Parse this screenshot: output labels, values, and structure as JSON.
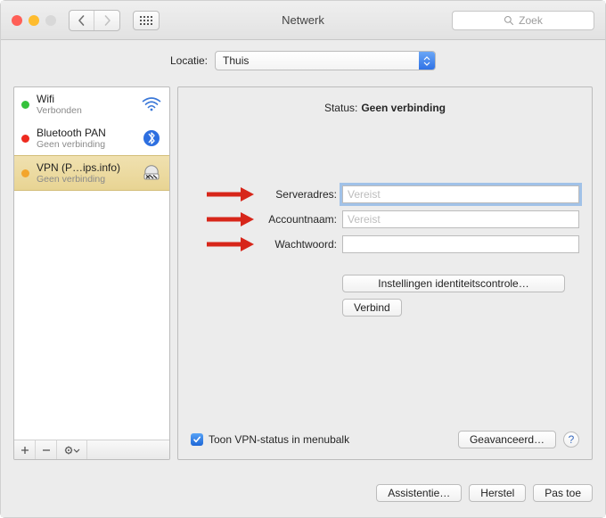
{
  "window": {
    "title": "Netwerk"
  },
  "search": {
    "placeholder": "Zoek"
  },
  "location": {
    "label": "Locatie:",
    "value": "Thuis"
  },
  "sidebar": {
    "items": [
      {
        "name": "Wifi",
        "status": "Verbonden",
        "dot": "green",
        "icon": "wifi"
      },
      {
        "name": "Bluetooth PAN",
        "status": "Geen verbinding",
        "dot": "red",
        "icon": "bluetooth"
      },
      {
        "name": "VPN (P…ips.info)",
        "status": "Geen verbinding",
        "dot": "orange",
        "icon": "vpn"
      }
    ]
  },
  "detail": {
    "status_label": "Status:",
    "status_value": "Geen verbinding",
    "fields": {
      "server_label": "Serveradres:",
      "server_placeholder": "Vereist",
      "account_label": "Accountnaam:",
      "account_placeholder": "Vereist",
      "password_label": "Wachtwoord:"
    },
    "auth_button": "Instellingen identiteitscontrole…",
    "connect_button": "Verbind",
    "menubar_checkbox": "Toon VPN-status in menubalk",
    "advanced_button": "Geavanceerd…"
  },
  "actions": {
    "assist": "Assistentie…",
    "revert": "Herstel",
    "apply": "Pas toe"
  },
  "colors": {
    "arrow": "#d7261a"
  }
}
